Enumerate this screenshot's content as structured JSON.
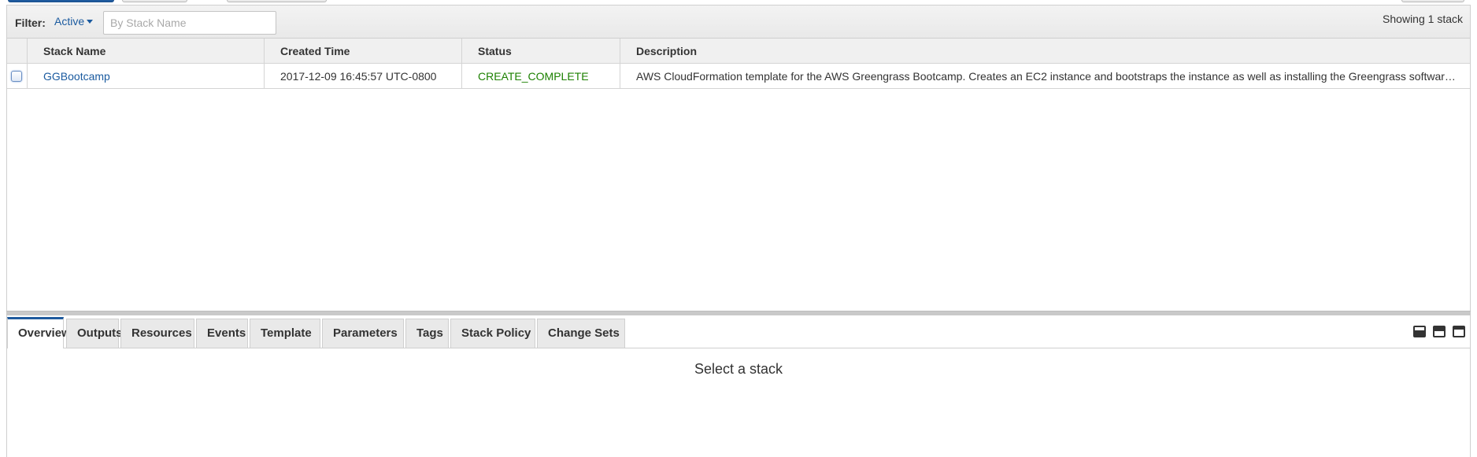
{
  "filter": {
    "label": "Filter:",
    "selected": "Active",
    "search_placeholder": "By Stack Name",
    "search_value": ""
  },
  "showing": "Showing 1 stack",
  "table": {
    "columns": [
      "Stack Name",
      "Created Time",
      "Status",
      "Description"
    ],
    "rows": [
      {
        "stack_name": "GGBootcamp",
        "created_time": "2017-12-09 16:45:57 UTC-0800",
        "status": "CREATE_COMPLETE",
        "description": "AWS CloudFormation template for the AWS Greengrass Bootcamp. Creates an EC2 instance and bootstraps the instance as well as installing the Greengrass software and configuring it"
      }
    ]
  },
  "tabs": [
    "Overview",
    "Outputs",
    "Resources",
    "Events",
    "Template",
    "Parameters",
    "Tags",
    "Stack Policy",
    "Change Sets"
  ],
  "active_tab": "Overview",
  "detail_message": "Select a stack",
  "colors": {
    "link": "#1a5a9f",
    "status_complete": "#1d8102",
    "active_tab_accent": "#1f5a9e"
  },
  "icons": {
    "layout": [
      "layout-bottom-icon",
      "layout-split-icon",
      "layout-top-icon"
    ]
  }
}
